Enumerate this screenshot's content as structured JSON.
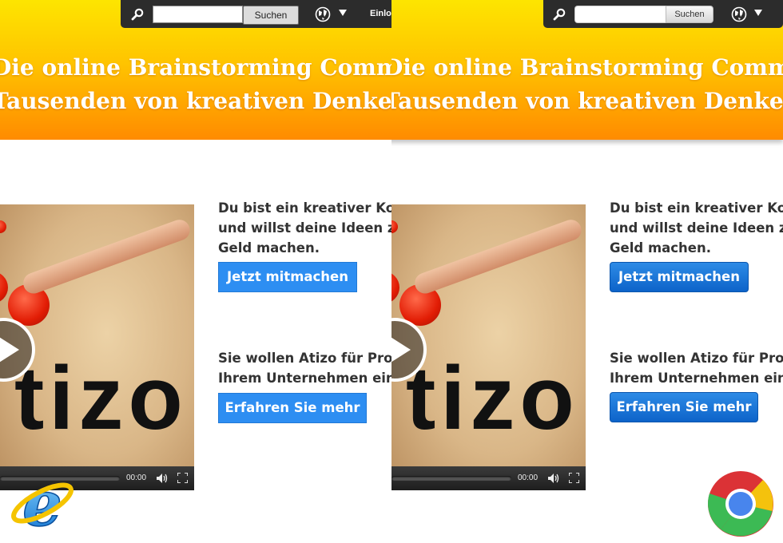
{
  "browsers": [
    "Internet Explorer",
    "Chrome"
  ],
  "header": {
    "search_placeholder": "",
    "search_button": "Suchen",
    "login_label": "Einlo"
  },
  "hero": {
    "line1": "Die online Brainstorming Community",
    "line2": "Tausenden von kreativen Denkern."
  },
  "video": {
    "logo_text": "tizo",
    "time": "00:00",
    "progress": 0
  },
  "cta": {
    "creative_line1": "Du bist ein kreativer Kopf",
    "creative_line2": "und willst deine Ideen zu",
    "creative_line3": "Geld machen.",
    "join_button": "Jetzt mitmachen",
    "business_line1": "Sie wollen Atizo für Projekte in",
    "business_line2": "Ihrem Unternehmen einsetzen?",
    "learn_button": "Erfahren Sie mehr"
  },
  "colors": {
    "banner_top": "#fde500",
    "banner_bottom": "#ff8b00",
    "topbar": "#2c2c2c",
    "button_blue": "#2d8ef2",
    "button_blue_dark": "#0d63c9",
    "text_dark": "#333333"
  },
  "icons": [
    "search-icon",
    "globe-icon",
    "caret-down-icon",
    "play-icon",
    "volume-icon",
    "fullscreen-icon",
    "ie-logo",
    "chrome-logo"
  ]
}
